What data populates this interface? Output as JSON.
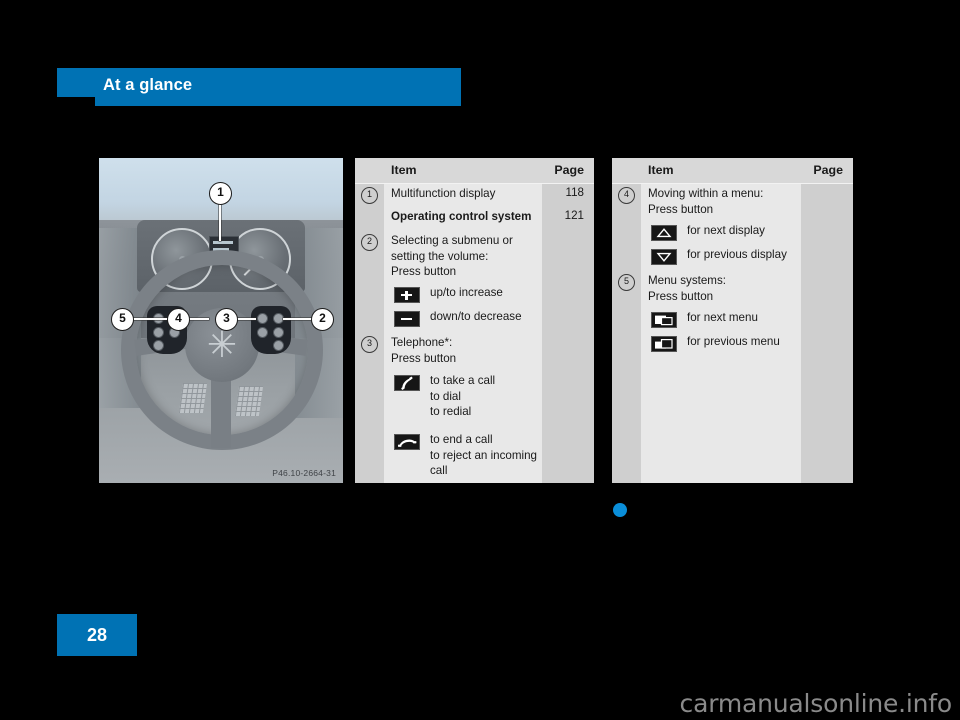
{
  "header": {
    "title": "At a glance"
  },
  "figure": {
    "alt_name": "steering-wheel-controls-photo",
    "code": "P46.10-2664-31",
    "callouts": [
      "1",
      "2",
      "3",
      "4",
      "5"
    ]
  },
  "tables": [
    {
      "id": "middle",
      "columns": {
        "item": "Item",
        "page": "Page"
      },
      "rows": [
        {
          "num": "1",
          "text": "Multifunction display",
          "bold": false,
          "page": "118"
        },
        {
          "num": "",
          "text": "Operating control system",
          "bold": true,
          "page": "121"
        },
        {
          "num": "2",
          "text": "Selecting a submenu or\nsetting the volume:\nPress button",
          "bold": false,
          "page": ""
        }
      ],
      "icon_rows": [
        {
          "icon": "plus-button-icon",
          "label": "up/to increase"
        },
        {
          "icon": "minus-button-icon",
          "label": "down/to decrease"
        }
      ],
      "rows2": [
        {
          "num": "3",
          "text": "Telephone*:\nPress button",
          "bold": false,
          "page": ""
        }
      ],
      "icon_rows2": [
        {
          "icon": "phone-accept-icon",
          "label": "to take a call\nto dial\nto redial"
        },
        {
          "icon": "phone-end-icon",
          "label": "to end a call\nto reject an incoming\ncall"
        }
      ]
    },
    {
      "id": "right",
      "columns": {
        "item": "Item",
        "page": "Page"
      },
      "rows": [
        {
          "num": "4",
          "text": "Moving within a menu:\nPress button",
          "bold": false,
          "page": ""
        }
      ],
      "icon_rows": [
        {
          "icon": "arrow-up-button-icon",
          "label": "for next display"
        },
        {
          "icon": "arrow-down-button-icon",
          "label": "for previous display"
        }
      ],
      "rows2": [
        {
          "num": "5",
          "text": "Menu systems:\nPress button",
          "bold": false,
          "page": ""
        }
      ],
      "icon_rows2": [
        {
          "icon": "next-menu-button-icon",
          "label": "for next menu"
        },
        {
          "icon": "previous-menu-button-icon",
          "label": "for previous menu"
        }
      ]
    }
  ],
  "footer": {
    "page_number": "28",
    "watermark": "carmanualsonline.info"
  },
  "colors": {
    "brand_blue": "#0072b4",
    "dot_blue": "#0a8ed9",
    "table_bg": "#e8e8e8",
    "table_col_gray": "#cfcfcf",
    "table_header_gray": "#d8d8d8"
  }
}
